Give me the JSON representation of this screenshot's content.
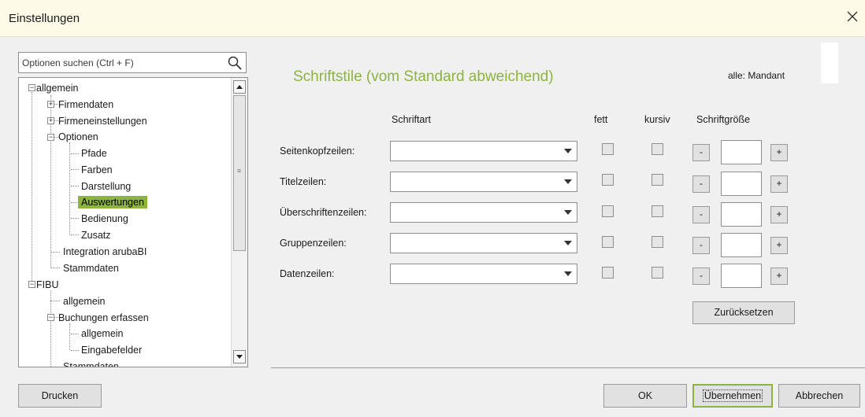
{
  "window": {
    "title": "Einstellungen"
  },
  "search": {
    "placeholder": "Optionen suchen (Ctrl + F)"
  },
  "tree": {
    "items": [
      {
        "label": "allgemein"
      },
      {
        "label": "Firmendaten"
      },
      {
        "label": "Firmeneinstellungen"
      },
      {
        "label": "Optionen"
      },
      {
        "label": "Pfade"
      },
      {
        "label": "Farben"
      },
      {
        "label": "Darstellung"
      },
      {
        "label": "Auswertungen"
      },
      {
        "label": "Bedienung"
      },
      {
        "label": "Zusatz"
      },
      {
        "label": "Integration arubaBI"
      },
      {
        "label": "Stammdaten"
      },
      {
        "label": "FIBU"
      },
      {
        "label": "allgemein"
      },
      {
        "label": "Buchungen erfassen"
      },
      {
        "label": "allgemein"
      },
      {
        "label": "Eingabefelder"
      },
      {
        "label": "Stammdaten"
      }
    ],
    "selected": "Auswertungen"
  },
  "panel": {
    "title": "Schriftstile (vom Standard abweichend)",
    "scope": "alle: Mandant",
    "headers": {
      "font": "Schriftart",
      "bold": "fett",
      "italic": "kursiv",
      "size": "Schriftgröße"
    },
    "rows": [
      {
        "label": "Seitenkopfzeilen:",
        "font": "",
        "size": ""
      },
      {
        "label": "Titelzeilen:",
        "font": "",
        "size": ""
      },
      {
        "label": "Überschriftenzeilen:",
        "font": "",
        "size": ""
      },
      {
        "label": "Gruppenzeilen:",
        "font": "",
        "size": ""
      },
      {
        "label": "Datenzeilen:",
        "font": "",
        "size": ""
      }
    ],
    "minus": "-",
    "plus": "+",
    "reset_label": "Zurücksetzen"
  },
  "footer": {
    "print_label": "Drucken",
    "ok_label": "OK",
    "apply_label": "Übernehmen",
    "cancel_label": "Abbrechen"
  },
  "colors": {
    "accent": "#8cb43f",
    "titlebar": "#fdfbe7",
    "background": "#f0f0f0"
  }
}
